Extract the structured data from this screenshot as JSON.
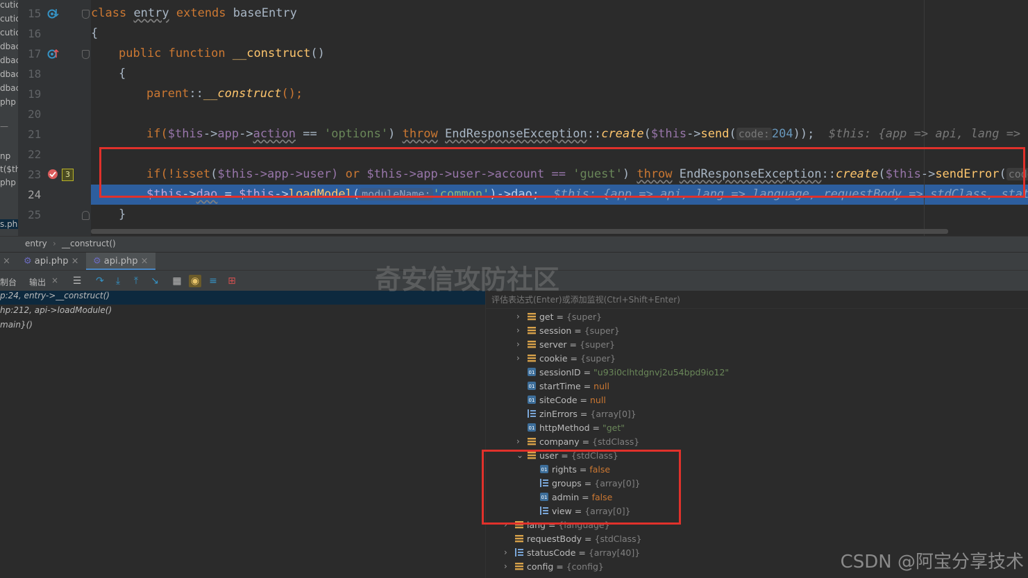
{
  "project_strip": [
    "cutic",
    "cutic",
    "cutic",
    "dbac",
    "dbac",
    "dbac",
    "dbac",
    "php",
    "np",
    "t($th",
    "php",
    "s.ph"
  ],
  "gutter": {
    "lines": [
      "15",
      "16",
      "17",
      "18",
      "19",
      "20",
      "21",
      "22",
      "23",
      "24",
      "25"
    ],
    "breakpoint_count": "3"
  },
  "code": {
    "l15": {
      "kw1": "class",
      "name": "entry",
      "kw2": "extends",
      "parent": "baseEntry"
    },
    "l16": "{",
    "l17": {
      "kw1": "public",
      "kw2": "function",
      "fn": "__construct",
      "rest": "()"
    },
    "l18": "{",
    "l19": {
      "kw": "parent",
      "sep": "::",
      "fn": "__construct",
      "rest": "();"
    },
    "l21": {
      "if": "if(",
      "this": "$this",
      "arrow1": "->",
      "app": "app",
      "arrow2": "->",
      "action": "action",
      "eq": " == ",
      "str": "'options'",
      "close": ") ",
      "throw": "throw",
      "cls": "EndResponseException",
      "dc": "::",
      "create": "create",
      "open": "(",
      "this2": "$this",
      "arrow3": "->",
      "send": "send",
      "open2": "(",
      "hint": "code:",
      "num": "204",
      "end": "));",
      "comment": "$this: {app => api, lang => la"
    },
    "l23": {
      "a": "if(!",
      "isset": "isset",
      "b": "(",
      "this": "$this",
      "c": "->app->user) ",
      "or": "or",
      "d": " ",
      "this2": "$this",
      "e": "->app->user->account == ",
      "str": "'guest'",
      "f": ") ",
      "throw": "throw",
      "g": " ",
      "cls": "EndResponseException",
      "h": "::",
      "create": "create",
      "i": "(",
      "this3": "$this",
      "j": "->",
      "send": "sendError",
      "k": "(",
      "hint": "code:"
    },
    "l24": {
      "this": "$this",
      "a": "->",
      "dao": "dao",
      "b": " = ",
      "this2": "$this",
      "c": "->",
      "load": "loadModel",
      "d": "(",
      "hint": "moduleName:",
      "str": "'common'",
      "e": ")->dao;",
      "comment": "$this: {app => api, lang => language, requestBody => stdClass, stat"
    },
    "l25": "}"
  },
  "breadcrumb": {
    "a": "entry",
    "sep": "›",
    "b": "__construct()"
  },
  "tabs": [
    {
      "label": "api.php",
      "close": "×"
    },
    {
      "label": "api.php",
      "close": "×"
    }
  ],
  "debug_toolbar": {
    "console": "制台",
    "output": "输出",
    "close": "×"
  },
  "frames": [
    {
      "text": "p:24, entry->__construct()"
    },
    {
      "text": "hp:212, api->loadModule()"
    },
    {
      "text": "main}()"
    }
  ],
  "eval_placeholder": "评估表达式(Enter)或添加监视(Ctrl+Shift+Enter)",
  "variables": [
    {
      "name": "get",
      "val": "{super}",
      "kind": "obj"
    },
    {
      "name": "session",
      "val": "{super}",
      "kind": "obj"
    },
    {
      "name": "server",
      "val": "{super}",
      "kind": "obj"
    },
    {
      "name": "cookie",
      "val": "{super}",
      "kind": "obj"
    },
    {
      "name": "sessionID",
      "val": "\"u93i0clhtdgnvj2u54bpd9io12\"",
      "kind": "str"
    },
    {
      "name": "startTime",
      "val": "null",
      "kind": "kw"
    },
    {
      "name": "siteCode",
      "val": "null",
      "kind": "kw"
    },
    {
      "name": "zinErrors",
      "val": "{array[0]}",
      "kind": "arr"
    },
    {
      "name": "httpMethod",
      "val": "\"get\"",
      "kind": "str"
    },
    {
      "name": "company",
      "val": "{stdClass}",
      "kind": "obj"
    },
    {
      "name": "user",
      "val": "{stdClass}",
      "kind": "obj"
    },
    {
      "name": "rights",
      "val": "false",
      "kind": "kw"
    },
    {
      "name": "groups",
      "val": "{array[0]}",
      "kind": "arr"
    },
    {
      "name": "admin",
      "val": "false",
      "kind": "kw"
    },
    {
      "name": "view",
      "val": "{array[0]}",
      "kind": "arr"
    },
    {
      "name": "lang",
      "val": "{language}",
      "kind": "obj"
    },
    {
      "name": "requestBody",
      "val": "{stdClass}",
      "kind": "obj"
    },
    {
      "name": "statusCode",
      "val": "{array[40]}",
      "kind": "arr"
    },
    {
      "name": "config",
      "val": "{config}",
      "kind": "obj"
    }
  ],
  "eq": "=",
  "watermark": "奇安信攻防社区",
  "csdn": "CSDN @阿宝分享技术",
  "colors": {
    "exec_line": "#2d5e9e",
    "highlight_box": "#e0312b",
    "bg": "#2b2b2b"
  }
}
